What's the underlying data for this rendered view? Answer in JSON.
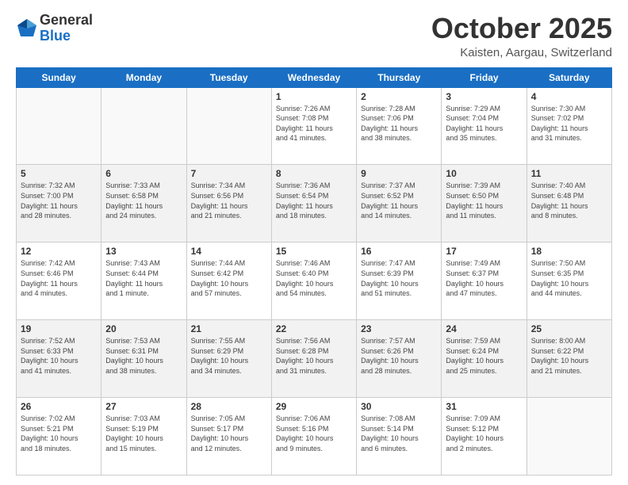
{
  "header": {
    "logo": {
      "line1": "General",
      "line2": "Blue"
    },
    "title": "October 2025",
    "location": "Kaisten, Aargau, Switzerland"
  },
  "days_of_week": [
    "Sunday",
    "Monday",
    "Tuesday",
    "Wednesday",
    "Thursday",
    "Friday",
    "Saturday"
  ],
  "weeks": [
    [
      {
        "day": "",
        "info": ""
      },
      {
        "day": "",
        "info": ""
      },
      {
        "day": "",
        "info": ""
      },
      {
        "day": "1",
        "info": "Sunrise: 7:26 AM\nSunset: 7:08 PM\nDaylight: 11 hours\nand 41 minutes."
      },
      {
        "day": "2",
        "info": "Sunrise: 7:28 AM\nSunset: 7:06 PM\nDaylight: 11 hours\nand 38 minutes."
      },
      {
        "day": "3",
        "info": "Sunrise: 7:29 AM\nSunset: 7:04 PM\nDaylight: 11 hours\nand 35 minutes."
      },
      {
        "day": "4",
        "info": "Sunrise: 7:30 AM\nSunset: 7:02 PM\nDaylight: 11 hours\nand 31 minutes."
      }
    ],
    [
      {
        "day": "5",
        "info": "Sunrise: 7:32 AM\nSunset: 7:00 PM\nDaylight: 11 hours\nand 28 minutes."
      },
      {
        "day": "6",
        "info": "Sunrise: 7:33 AM\nSunset: 6:58 PM\nDaylight: 11 hours\nand 24 minutes."
      },
      {
        "day": "7",
        "info": "Sunrise: 7:34 AM\nSunset: 6:56 PM\nDaylight: 11 hours\nand 21 minutes."
      },
      {
        "day": "8",
        "info": "Sunrise: 7:36 AM\nSunset: 6:54 PM\nDaylight: 11 hours\nand 18 minutes."
      },
      {
        "day": "9",
        "info": "Sunrise: 7:37 AM\nSunset: 6:52 PM\nDaylight: 11 hours\nand 14 minutes."
      },
      {
        "day": "10",
        "info": "Sunrise: 7:39 AM\nSunset: 6:50 PM\nDaylight: 11 hours\nand 11 minutes."
      },
      {
        "day": "11",
        "info": "Sunrise: 7:40 AM\nSunset: 6:48 PM\nDaylight: 11 hours\nand 8 minutes."
      }
    ],
    [
      {
        "day": "12",
        "info": "Sunrise: 7:42 AM\nSunset: 6:46 PM\nDaylight: 11 hours\nand 4 minutes."
      },
      {
        "day": "13",
        "info": "Sunrise: 7:43 AM\nSunset: 6:44 PM\nDaylight: 11 hours\nand 1 minute."
      },
      {
        "day": "14",
        "info": "Sunrise: 7:44 AM\nSunset: 6:42 PM\nDaylight: 10 hours\nand 57 minutes."
      },
      {
        "day": "15",
        "info": "Sunrise: 7:46 AM\nSunset: 6:40 PM\nDaylight: 10 hours\nand 54 minutes."
      },
      {
        "day": "16",
        "info": "Sunrise: 7:47 AM\nSunset: 6:39 PM\nDaylight: 10 hours\nand 51 minutes."
      },
      {
        "day": "17",
        "info": "Sunrise: 7:49 AM\nSunset: 6:37 PM\nDaylight: 10 hours\nand 47 minutes."
      },
      {
        "day": "18",
        "info": "Sunrise: 7:50 AM\nSunset: 6:35 PM\nDaylight: 10 hours\nand 44 minutes."
      }
    ],
    [
      {
        "day": "19",
        "info": "Sunrise: 7:52 AM\nSunset: 6:33 PM\nDaylight: 10 hours\nand 41 minutes."
      },
      {
        "day": "20",
        "info": "Sunrise: 7:53 AM\nSunset: 6:31 PM\nDaylight: 10 hours\nand 38 minutes."
      },
      {
        "day": "21",
        "info": "Sunrise: 7:55 AM\nSunset: 6:29 PM\nDaylight: 10 hours\nand 34 minutes."
      },
      {
        "day": "22",
        "info": "Sunrise: 7:56 AM\nSunset: 6:28 PM\nDaylight: 10 hours\nand 31 minutes."
      },
      {
        "day": "23",
        "info": "Sunrise: 7:57 AM\nSunset: 6:26 PM\nDaylight: 10 hours\nand 28 minutes."
      },
      {
        "day": "24",
        "info": "Sunrise: 7:59 AM\nSunset: 6:24 PM\nDaylight: 10 hours\nand 25 minutes."
      },
      {
        "day": "25",
        "info": "Sunrise: 8:00 AM\nSunset: 6:22 PM\nDaylight: 10 hours\nand 21 minutes."
      }
    ],
    [
      {
        "day": "26",
        "info": "Sunrise: 7:02 AM\nSunset: 5:21 PM\nDaylight: 10 hours\nand 18 minutes."
      },
      {
        "day": "27",
        "info": "Sunrise: 7:03 AM\nSunset: 5:19 PM\nDaylight: 10 hours\nand 15 minutes."
      },
      {
        "day": "28",
        "info": "Sunrise: 7:05 AM\nSunset: 5:17 PM\nDaylight: 10 hours\nand 12 minutes."
      },
      {
        "day": "29",
        "info": "Sunrise: 7:06 AM\nSunset: 5:16 PM\nDaylight: 10 hours\nand 9 minutes."
      },
      {
        "day": "30",
        "info": "Sunrise: 7:08 AM\nSunset: 5:14 PM\nDaylight: 10 hours\nand 6 minutes."
      },
      {
        "day": "31",
        "info": "Sunrise: 7:09 AM\nSunset: 5:12 PM\nDaylight: 10 hours\nand 2 minutes."
      },
      {
        "day": "",
        "info": ""
      }
    ]
  ],
  "row_styles": [
    "light",
    "gray",
    "light",
    "gray",
    "light"
  ]
}
